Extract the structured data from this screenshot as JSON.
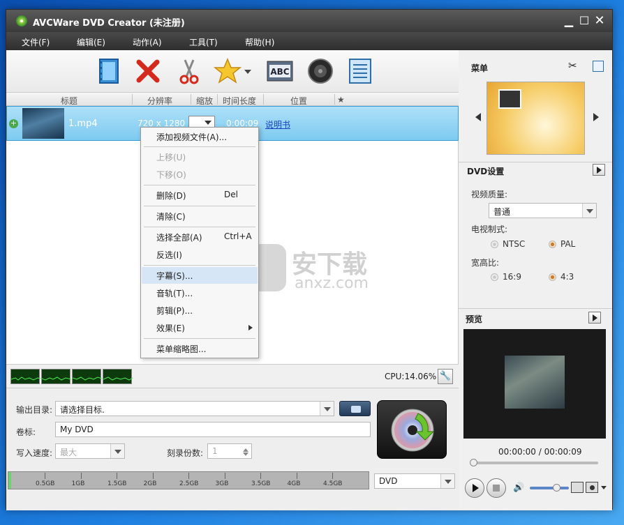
{
  "window": {
    "title": "AVCWare DVD Creator (未注册)"
  },
  "menu": [
    "文件(F)",
    "编辑(E)",
    "动作(A)",
    "工具(T)",
    "帮助(H)"
  ],
  "columns": {
    "title": "标题",
    "resolution": "分辨率",
    "zoom": "缩放",
    "duration": "时间长度",
    "position": "位置",
    "star": "★"
  },
  "file_row": {
    "name": "1.mp4",
    "resolution": "720 x 1280",
    "duration": "0:00:09",
    "link": "说明书"
  },
  "context_menu": [
    {
      "label": "添加视频文件(A)...",
      "shortcut": "",
      "disabled": false
    },
    {
      "label": "上移(U)",
      "shortcut": "",
      "disabled": true
    },
    {
      "label": "下移(O)",
      "shortcut": "",
      "disabled": true
    },
    {
      "label": "删除(D)",
      "shortcut": "Del",
      "disabled": false
    },
    {
      "label": "清除(C)",
      "shortcut": "",
      "disabled": false
    },
    {
      "label": "选择全部(A)",
      "shortcut": "Ctrl+A",
      "disabled": false
    },
    {
      "label": "反选(I)",
      "shortcut": "",
      "disabled": false
    },
    {
      "label": "字幕(S)...",
      "shortcut": "",
      "disabled": false
    },
    {
      "label": "音轨(T)...",
      "shortcut": "",
      "disabled": false
    },
    {
      "label": "剪辑(P)...",
      "shortcut": "",
      "disabled": false
    },
    {
      "label": "效果(E)",
      "shortcut": "",
      "disabled": false
    },
    {
      "label": "菜单缩略图...",
      "shortcut": "",
      "disabled": false
    }
  ],
  "cpu": "CPU:14.06%",
  "output": {
    "dir_label": "输出目录:",
    "dir_value": "请选择目标.",
    "vol_label": "卷标:",
    "vol_value": "My DVD",
    "speed_label": "写入速度:",
    "speed_value": "最大",
    "copies_label": "刻录份数:",
    "copies_value": "1"
  },
  "disk_ticks": [
    "0.5GB",
    "1GB",
    "1.5GB",
    "2GB",
    "2.5GB",
    "3GB",
    "3.5GB",
    "4GB",
    "4.5GB"
  ],
  "disc_type": "DVD",
  "right": {
    "menu_title": "菜单",
    "dvd_settings": "DVD设置",
    "quality_label": "视频质量:",
    "quality_value": "普通",
    "tv_label": "电视制式:",
    "ntsc": "NTSC",
    "pal": "PAL",
    "aspect_label": "宽高比:",
    "aspect_169": "16:9",
    "aspect_43": "4:3",
    "preview_title": "预览",
    "time": "00:00:00 / 00:00:09"
  },
  "watermark": {
    "cn": "安下载",
    "en": "anxz.com"
  },
  "colors": {
    "selected_row": "#8dd0f2",
    "titlebar": "#3f3f3f",
    "menu_orange": "#f2b43c"
  }
}
